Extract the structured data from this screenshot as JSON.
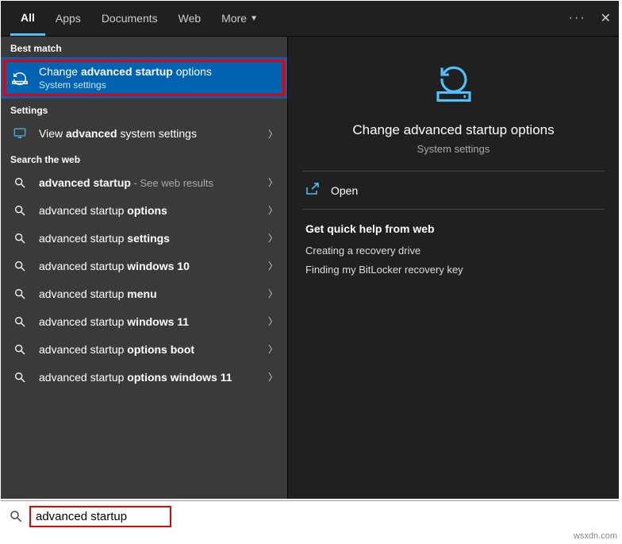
{
  "header": {
    "tabs": [
      {
        "label": "All",
        "active": true
      },
      {
        "label": "Apps"
      },
      {
        "label": "Documents"
      },
      {
        "label": "Web"
      },
      {
        "label": "More",
        "dropdown": true
      }
    ],
    "more_icon": "more-icon",
    "close_icon": "close-icon"
  },
  "left": {
    "best_match_header": "Best match",
    "best_match": {
      "title_pre": "Change ",
      "title_bold": "advanced startup",
      "title_post": " options",
      "subtitle": "System settings"
    },
    "settings_header": "Settings",
    "settings_item": {
      "pre": "View ",
      "bold": "advanced",
      "post": " system settings"
    },
    "web_header": "Search the web",
    "web_items": [
      {
        "pre": "",
        "bold": "advanced startup",
        "post": "",
        "sub": " - See web results"
      },
      {
        "pre": "advanced startup ",
        "bold": "options",
        "post": ""
      },
      {
        "pre": "advanced startup ",
        "bold": "settings",
        "post": ""
      },
      {
        "pre": "advanced startup ",
        "bold": "windows 10",
        "post": ""
      },
      {
        "pre": "advanced startup ",
        "bold": "menu",
        "post": ""
      },
      {
        "pre": "advanced startup ",
        "bold": "windows 11",
        "post": ""
      },
      {
        "pre": "advanced startup ",
        "bold": "options boot",
        "post": ""
      },
      {
        "pre": "advanced startup ",
        "bold": "options windows 11",
        "post": ""
      }
    ]
  },
  "right": {
    "title": "Change advanced startup options",
    "subtitle": "System settings",
    "open_label": "Open",
    "help_header": "Get quick help from web",
    "help_links": [
      "Creating a recovery drive",
      "Finding my BitLocker recovery key"
    ]
  },
  "search": {
    "value": "advanced startup"
  },
  "watermark": "wsxdn.com",
  "colors": {
    "accent": "#4cc2ff",
    "highlight_border": "#e60000",
    "selected": "#0063b1"
  }
}
